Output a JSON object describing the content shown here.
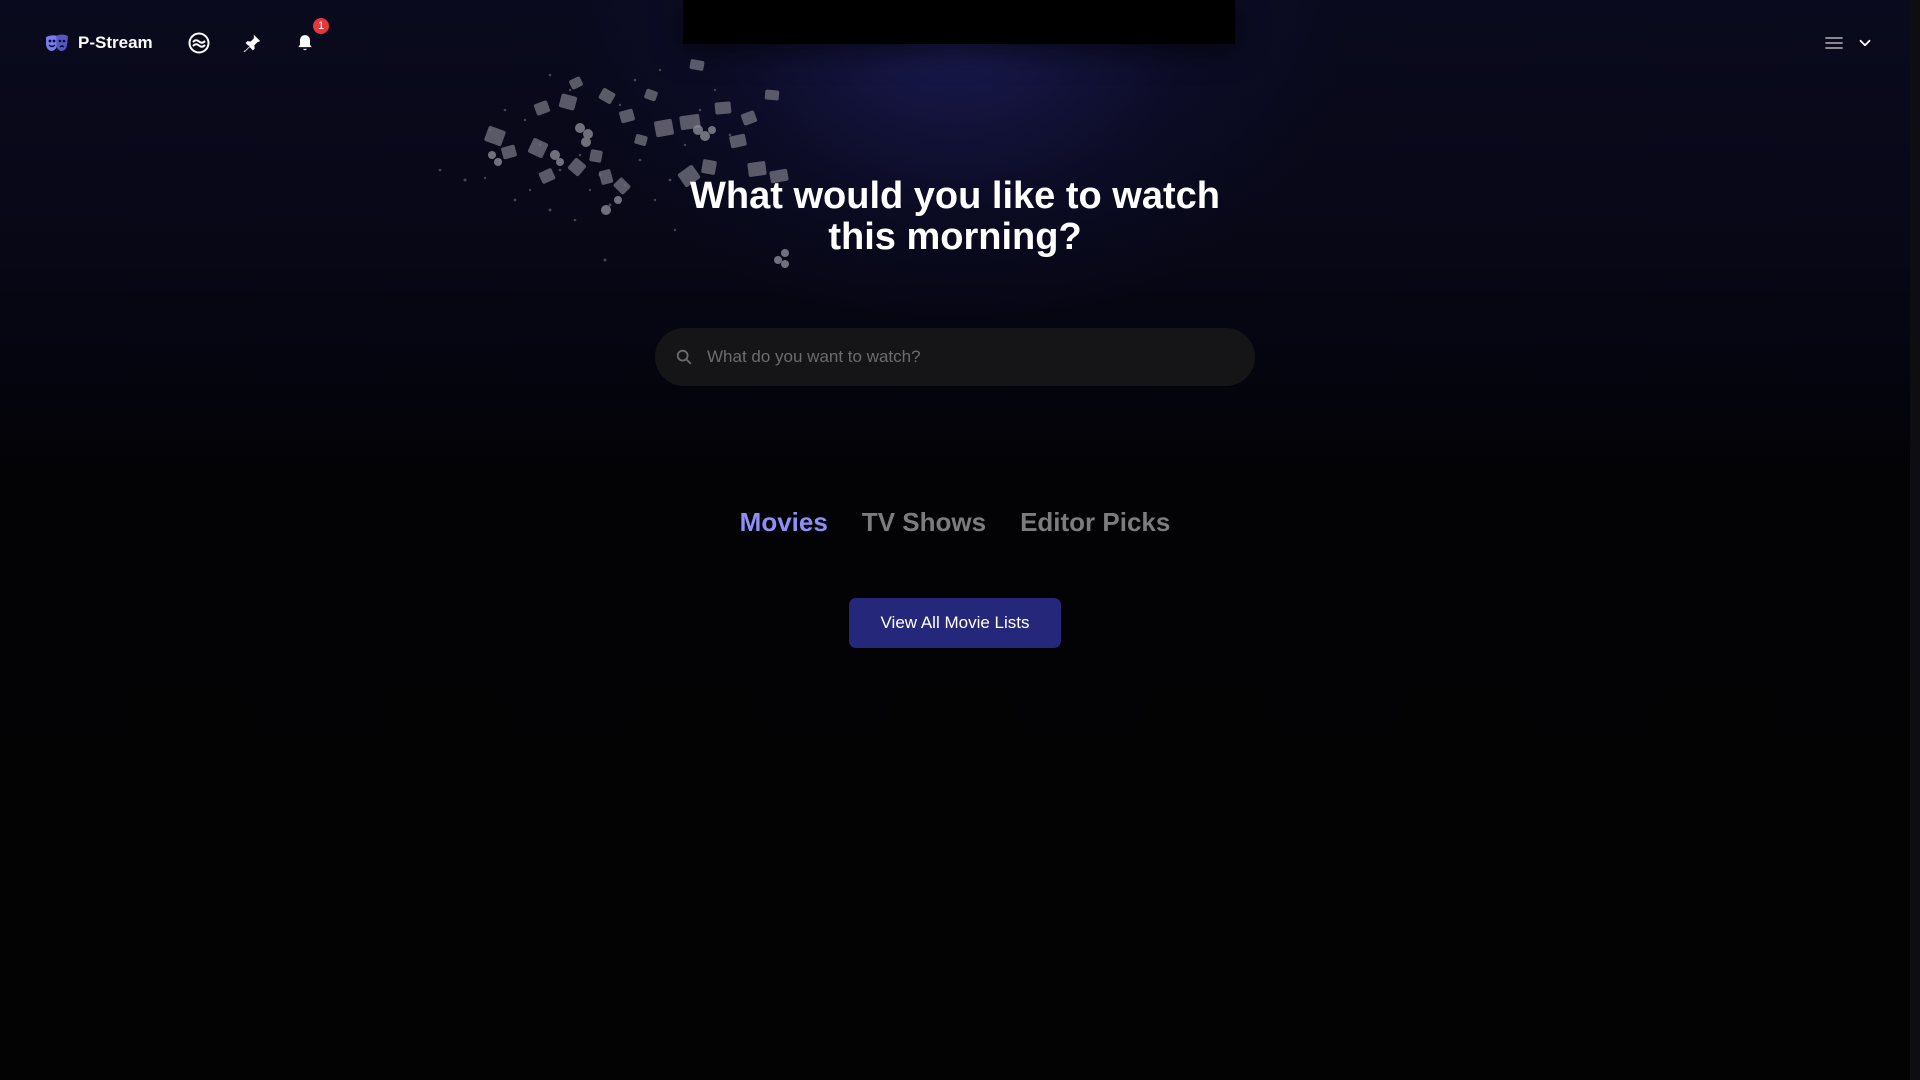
{
  "header": {
    "brand_name": "P-Stream",
    "notification_count": "1",
    "icons": {
      "brand": "theater-masks-icon",
      "discover": "waves-icon",
      "pinned": "pin-icon",
      "notifications": "bell-icon",
      "menu": "hamburger-menu-icon",
      "menu_chevron": "chevron-down-icon"
    }
  },
  "hero": {
    "title": "What would you like to watch this morning?"
  },
  "search": {
    "placeholder": "What do you want to watch?",
    "icon": "search-icon"
  },
  "tabs": [
    {
      "label": "Movies",
      "active": true
    },
    {
      "label": "TV Shows",
      "active": false
    },
    {
      "label": "Editor Picks",
      "active": false
    }
  ],
  "cta": {
    "label": "View All Movie Lists"
  },
  "colors": {
    "accent": "#8e8ef5",
    "brand_logo": "#7b7bf0",
    "button_bg": "#25277a",
    "badge": "#e5383b",
    "tab_inactive": "#7b7b80"
  }
}
